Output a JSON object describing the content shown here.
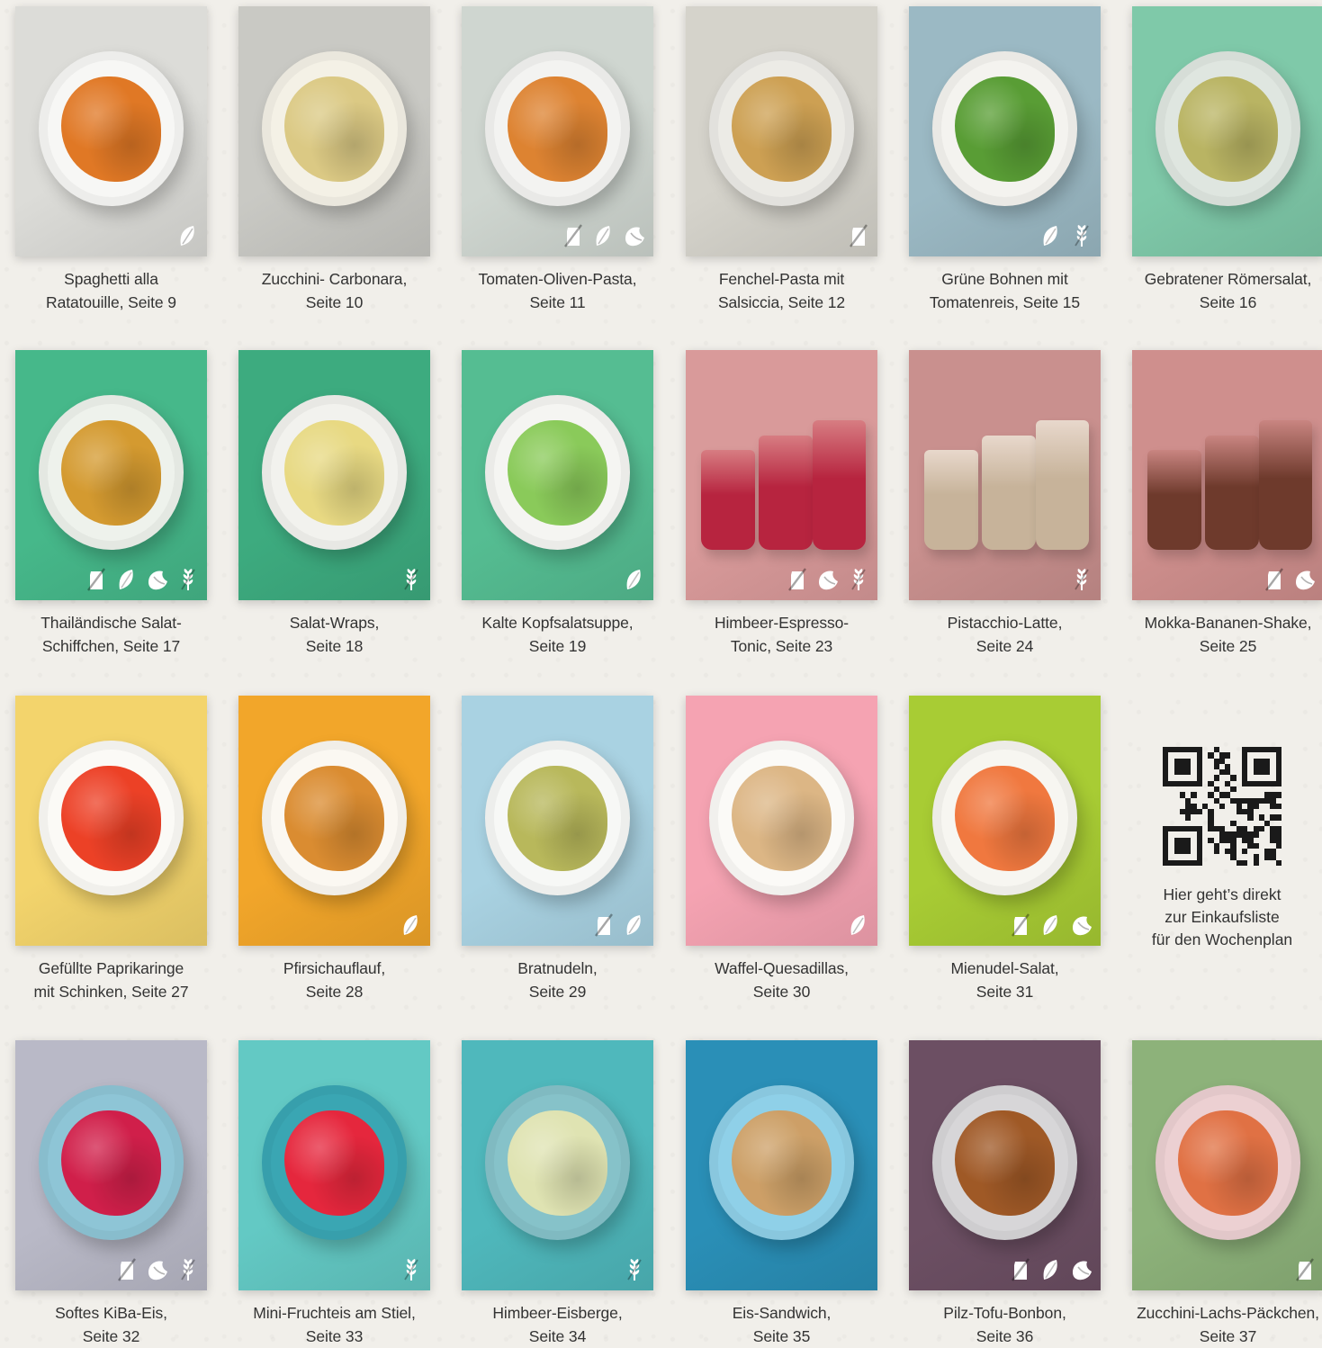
{
  "qr": {
    "line1": "Hier geht’s direkt",
    "line2": "zur Einkaufsliste",
    "line3": "für den Wochenplan"
  },
  "recipes": [
    {
      "line1": "Spaghetti alla",
      "line2": "Ratatouille, Seite 9",
      "bg": "#dcdcd8",
      "plate": "#f7f7f5",
      "food": "#d8792e",
      "icons": [
        "leaf-icon"
      ]
    },
    {
      "line1": "Zucchini- Carbonara,",
      "line2": "Seite 10",
      "bg": "#c9c9c4",
      "plate": "#f4f1e6",
      "food": "#d9c98a",
      "icons": []
    },
    {
      "line1": "Tomaten-Oliven-Pasta,",
      "line2": "Seite 11",
      "bg": "#cfd6d0",
      "plate": "#f3f3f1",
      "food": "#d6843a",
      "icons": [
        "no-gluten-icon",
        "leaf-icon",
        "lactose-free-icon"
      ]
    },
    {
      "line1": "Fenchel-Pasta mit",
      "line2": "Salsiccia, Seite 12",
      "bg": "#d5d3cb",
      "plate": "#ecebe6",
      "food": "#c9a05a",
      "icons": [
        "no-gluten-icon"
      ]
    },
    {
      "line1": "Grüne Bohnen mit",
      "line2": "Tomatenreis, Seite 15",
      "bg": "#9bb9c4",
      "plate": "#f4f3ef",
      "food": "#5d9b3c",
      "icons": [
        "leaf-icon",
        "no-wheat-icon"
      ]
    },
    {
      "line1": "Gebratener Römersalat,",
      "line2": "Seite 16",
      "bg": "#7fc9a9",
      "plate": "#dfe6e0",
      "food": "#b8b46a",
      "icons": []
    },
    {
      "line1": "Thailändische Salat-",
      "line2": "Schiffchen, Seite 17",
      "bg": "#46b88a",
      "plate": "#eef2ec",
      "food": "#cf9a3a",
      "icons": [
        "no-gluten-icon",
        "leaf-icon",
        "lactose-free-icon",
        "no-wheat-icon"
      ]
    },
    {
      "line1": "Salat-Wraps,",
      "line2": "Seite 18",
      "bg": "#3dab7f",
      "plate": "#f2f2ee",
      "food": "#e6d98a",
      "icons": [
        "no-wheat-icon"
      ]
    },
    {
      "line1": "Kalte Kopfsalatsuppe,",
      "line2": "Seite 19",
      "bg": "#55bd92",
      "plate": "#f5f5f2",
      "food": "#8ec862",
      "icons": [
        "leaf-icon"
      ]
    },
    {
      "line1": "Himbeer-Espresso-",
      "line2": "Tonic, Seite 23",
      "bg": "#d99a9a",
      "plate": "#d77d82",
      "food": "#b7243f",
      "icons": [
        "no-gluten-icon",
        "lactose-free-icon",
        "no-wheat-icon"
      ]
    },
    {
      "line1": "Pistacchio-Latte,",
      "line2": "Seite 24",
      "bg": "#c9908e",
      "plate": "#e8d8cc",
      "food": "#c7b39a",
      "icons": [
        "no-wheat-icon"
      ]
    },
    {
      "line1": "Mokka-Bananen-Shake,",
      "line2": "Seite 25",
      "bg": "#cf8f8d",
      "plate": "#c98581",
      "food": "#6e3a2c",
      "icons": [
        "no-gluten-icon",
        "lactose-free-icon"
      ]
    },
    {
      "line1": "Gefüllte Paprikaringe",
      "line2": "mit Schinken, Seite 27",
      "bg": "#f3d46c",
      "plate": "#fbfaf6",
      "food": "#e0442c",
      "icons": []
    },
    {
      "line1": "Pfirsichauflauf,",
      "line2": "Seite 28",
      "bg": "#f2a62a",
      "plate": "#fbf8f2",
      "food": "#d48d3a",
      "icons": [
        "leaf-icon"
      ]
    },
    {
      "line1": "Bratnudeln,",
      "line2": "Seite 29",
      "bg": "#a9d2e2",
      "plate": "#f7f8f6",
      "food": "#b7b763",
      "icons": [
        "no-gluten-icon",
        "leaf-icon"
      ]
    },
    {
      "line1": "Waffel-Quesadillas,",
      "line2": "Seite 30",
      "bg": "#f5a3b2",
      "plate": "#fbfaf7",
      "food": "#d9b68a",
      "icons": [
        "leaf-icon"
      ]
    },
    {
      "line1": "Mienudel-Salat,",
      "line2": "Seite 31",
      "bg": "#a8cc34",
      "plate": "#f7f6f1",
      "food": "#e77a46",
      "icons": [
        "no-gluten-icon",
        "leaf-icon",
        "lactose-free-icon"
      ]
    },
    {
      "line1": "Softes KiBa-Eis,",
      "line2": "Seite 32",
      "bg": "#b9b9c7",
      "plate": "#8ec5d6",
      "food": "#c4234a",
      "icons": [
        "no-gluten-icon",
        "lactose-free-icon",
        "no-wheat-icon"
      ]
    },
    {
      "line1": "Mini-Fruchteis am Stiel,",
      "line2": "Seite 33",
      "bg": "#63c9c4",
      "plate": "#3aa6b3",
      "food": "#d82b3f",
      "icons": [
        "no-wheat-icon"
      ]
    },
    {
      "line1": "Himbeer-Eisberge,",
      "line2": "Seite 34",
      "bg": "#4fb8bc",
      "plate": "#86c2c9",
      "food": "#dfe3b6",
      "icons": [
        "no-wheat-icon"
      ]
    },
    {
      "line1": "Eis-Sandwich,",
      "line2": "Seite 35",
      "bg": "#2a8fb7",
      "plate": "#8fd0e8",
      "food": "#c9a06d",
      "icons": []
    },
    {
      "line1": "Pilz-Tofu-Bonbon,",
      "line2": "Seite 36",
      "bg": "#6c4f63",
      "plate": "#d7d6d8",
      "food": "#9a5a2c",
      "icons": [
        "no-gluten-icon",
        "leaf-icon",
        "lactose-free-icon"
      ]
    },
    {
      "line1": "Zucchini-Lachs-Päckchen,",
      "line2": "Seite 37",
      "bg": "#8db27a",
      "plate": "#ecd0d2",
      "food": "#d8734a",
      "icons": [
        "no-gluten-icon"
      ]
    }
  ]
}
